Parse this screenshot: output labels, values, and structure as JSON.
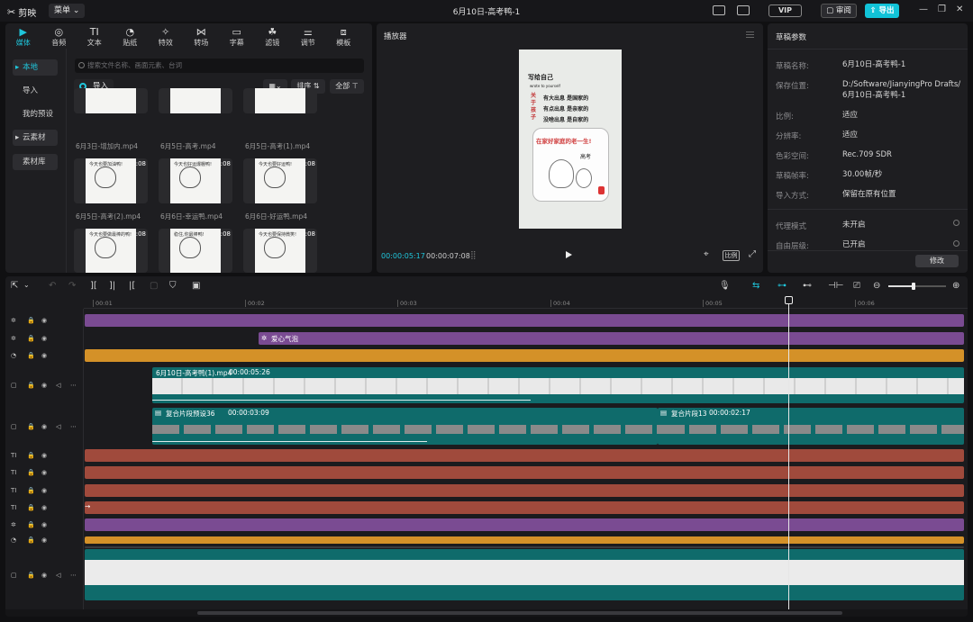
{
  "app": {
    "name": "剪映",
    "menu_label": "菜单",
    "title": "6月10日-高考鸭-1",
    "vip": "VIP",
    "review": "审阅",
    "export": "导出"
  },
  "media": {
    "tabs": [
      "媒体",
      "音频",
      "文本",
      "贴纸",
      "特效",
      "转场",
      "字幕",
      "滤镜",
      "调节",
      "模板"
    ],
    "tab_icons": [
      "media-icon",
      "audio-icon",
      "text-icon",
      "sticker-icon",
      "effects-icon",
      "transition-icon",
      "subtitle-icon",
      "filter-icon",
      "adjust-icon",
      "template-icon"
    ],
    "sidebar": [
      "本地",
      "导入",
      "我的预设",
      "云素材",
      "素材库"
    ],
    "search_placeholder": "搜索文件名称、画面元素、台词",
    "import_label": "导入",
    "sort_label": "排序",
    "all_label": "全部",
    "section": "全部",
    "thumbs": [
      {
        "cap": "6月3日-增加内.mp4",
        "dur": "",
        "txt": ""
      },
      {
        "cap": "6月5日-高考.mp4",
        "dur": "",
        "txt": ""
      },
      {
        "cap": "6月5日-高考(1).mp4",
        "dur": "",
        "txt": ""
      },
      {
        "cap": "6月5日-高考(2).mp4",
        "dur": ":08",
        "txt": "今天也要加油鸭!"
      },
      {
        "cap": "6月6日-幸运鸭.mp4",
        "dur": ":08",
        "txt": "今天也好运爆棚鸭!"
      },
      {
        "cap": "6月6日-好运鸭.mp4",
        "dur": ":08",
        "txt": "今天也要好运鸭!"
      },
      {
        "cap": "",
        "dur": ":08",
        "txt": "今天也要做最棒的鸭!"
      },
      {
        "cap": "",
        "dur": ":08",
        "txt": "稳住,你最棒鸭!"
      },
      {
        "cap": "",
        "dur": ":08",
        "txt": "今天也要保持微笑!"
      }
    ]
  },
  "player": {
    "title": "播放器",
    "current": "00:00:05:17",
    "total": "00:00:07:08",
    "ratio_label": "比例",
    "preview": {
      "heading": "写给自己",
      "sub": "wrote to yourself",
      "side": "关于孩子",
      "lines": [
        "有大出息 是国家的",
        "有点出息 是亲家的",
        "没啥出息 是自家的"
      ],
      "banner": "在家好家庭的老一生!",
      "tag": "高考"
    }
  },
  "draft": {
    "title": "草稿参数",
    "rows": [
      {
        "label": "草稿名称:",
        "value": "6月10日-高考鸭-1"
      },
      {
        "label": "保存位置:",
        "value": "D:/Software/JianyingPro Drafts/ 6月10日-高考鸭-1"
      },
      {
        "label": "比例:",
        "value": "适应"
      },
      {
        "label": "分辨率:",
        "value": "适应"
      },
      {
        "label": "色彩空间:",
        "value": "Rec.709 SDR"
      },
      {
        "label": "草稿帧率:",
        "value": "30.00帧/秒"
      },
      {
        "label": "导入方式:",
        "value": "保留在原有位置"
      },
      {
        "label": "代理模式",
        "value": "未开启"
      },
      {
        "label": "自由层级:",
        "value": "已开启"
      }
    ],
    "modify": "修改"
  },
  "timeline": {
    "ruler": [
      "00:01",
      "00:02",
      "00:03",
      "00:04",
      "00:05",
      "00:06"
    ],
    "effect_label": "爱心气泡",
    "main_clip": {
      "name": "6月10日-高考鸭(1).mp4",
      "duration": "00:00:05:26"
    },
    "compound1": {
      "name": "复合片段预设36",
      "duration": "00:00:03:09"
    },
    "compound2": {
      "name": "复合片段13",
      "duration": "00:00:02:17"
    },
    "colors": {
      "purple": "#7a4b92",
      "orange": "#d49128",
      "teal": "#0f6b6b",
      "brick": "#a04a3c"
    }
  }
}
